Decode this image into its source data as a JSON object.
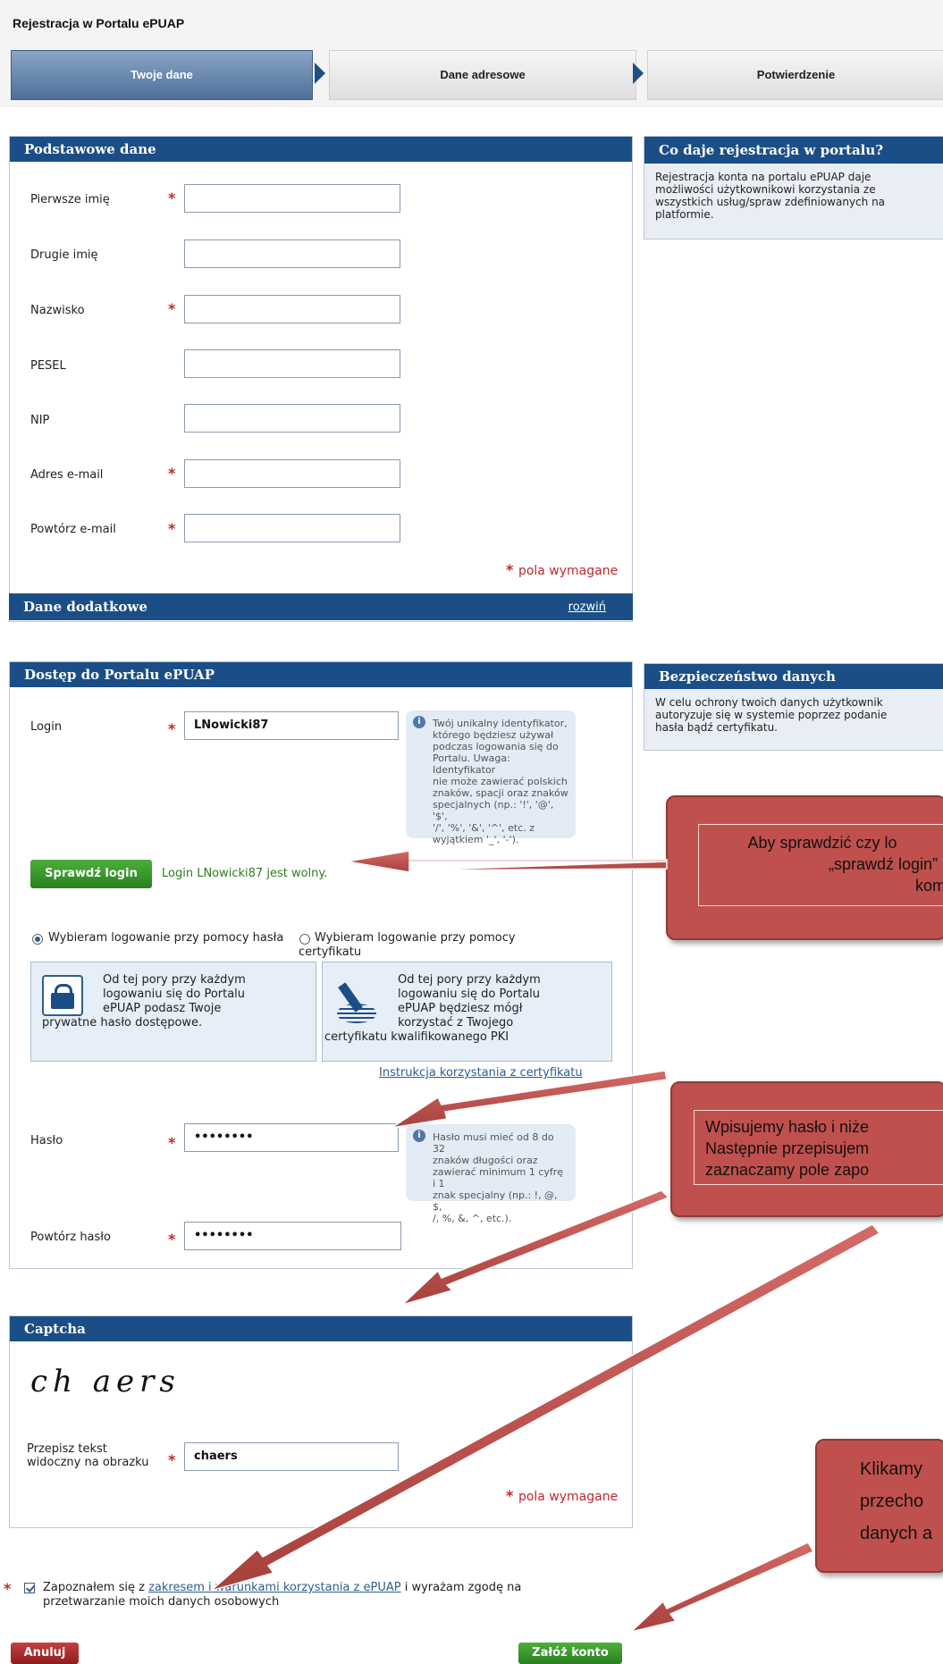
{
  "header": {
    "title": "Rejestracja w Portalu ePUAP",
    "steps": [
      "Twoje dane",
      "Dane adresowe",
      "Potwierdzenie"
    ]
  },
  "basic": {
    "title": "Podstawowe dane",
    "fields": [
      {
        "label": "Pierwsze imię",
        "value": ""
      },
      {
        "label": "Drugie imię",
        "value": ""
      },
      {
        "label": "Nazwisko",
        "value": ""
      },
      {
        "label": "PESEL",
        "value": ""
      },
      {
        "label": "NIP",
        "value": ""
      },
      {
        "label": "Adres e-mail",
        "value": ""
      },
      {
        "label": "Powtórz e-mail",
        "value": ""
      }
    ],
    "required_note": "pola wymagane",
    "extra_title": "Dane dodatkowe",
    "expand_link": "rozwiń"
  },
  "side1": {
    "title": "Co daje rejestracja w portalu?",
    "text": [
      "Rejestracja konta na portalu ePUAP daje",
      "możliwości użytkownikowi korzystania ze",
      "wszystkich usług/spraw zdefiniowanych na",
      "platformie."
    ]
  },
  "access": {
    "title": "Dostęp do Portalu ePUAP",
    "login_label": "Login",
    "login_value": "LNowicki87",
    "login_hint": [
      "Twój unikalny identyfikator,",
      "którego będziesz używał",
      "podczas logowania się do",
      "Portalu. Uwaga: Identyfikator",
      "nie może zawierać polskich",
      "znaków, spacji oraz znaków",
      "specjalnych (np.: '!', '@', '$',",
      "'/', '%', '&', '^', etc. z",
      "wyjątkiem '_', '-')."
    ],
    "check_button": "Sprawdź login",
    "check_result": "Login LNowicki87 jest wolny.",
    "option_password": "Wybieram logowanie przy pomocy hasła",
    "option_cert": [
      "Wybieram logowanie przy pomocy",
      "certyfikatu"
    ],
    "password_box": [
      "Od tej pory przy każdym",
      "logowaniu się do Portalu",
      "ePUAP podasz Twoje",
      "prywatne hasło dostępowe."
    ],
    "cert_box": [
      "Od tej pory przy każdym",
      "logowaniu się do Portalu",
      "ePUAP będziesz mógł",
      "korzystać z Twojego",
      "certyfikatu kwalifikowanego PKI"
    ],
    "cert_link": "Instrukcja korzystania z certyfikatu",
    "password_label": "Hasło",
    "password_value": "••••••••",
    "password_hint": [
      "Hasło musi mieć od 8 do 32",
      "znaków długości oraz",
      "zawierać minimum 1 cyfrę i 1",
      "znak specjalny (np.: !, @, $,",
      "/, %, &, ^, etc.)."
    ],
    "repeat_label": "Powtórz hasło",
    "repeat_value": "••••••••"
  },
  "side2": {
    "title": "Bezpieczeństwo danych",
    "text": [
      "W celu ochrony twoich danych użytkownik",
      "autoryzuje się w systemie poprzez podanie",
      "hasła bądź certyfikatu."
    ]
  },
  "captcha": {
    "title": "Captcha",
    "image_text": "ch aers",
    "label": [
      "Przepisz tekst",
      "widoczny na obrazku"
    ],
    "value": "chaers",
    "required_note": "pola wymagane"
  },
  "consent": {
    "prefix": "Zapoznałem się z",
    "link": "zakresem i warunkami korzystania z ePUAP",
    "suffix": "i wyrażam zgodę na",
    "line2": "przetwarzanie moich danych osobowych"
  },
  "buttons": {
    "cancel": "Anuluj",
    "create": "Załóż konto"
  },
  "callouts": {
    "c1": [
      "Aby sprawdzić czy lo",
      "„sprawdź login” i",
      "kom"
    ],
    "c2": [
      "Wpisujemy hasło i niże",
      "Następnie przepisujem",
      "zaznaczamy pole zapo"
    ],
    "c3": [
      "Klikamy",
      "przecho",
      "danych a"
    ]
  },
  "colors": {
    "panel_header": "#1b4e86",
    "required": "#c0282d",
    "callout": "#c0504d",
    "button_green": "#2b7f21"
  }
}
